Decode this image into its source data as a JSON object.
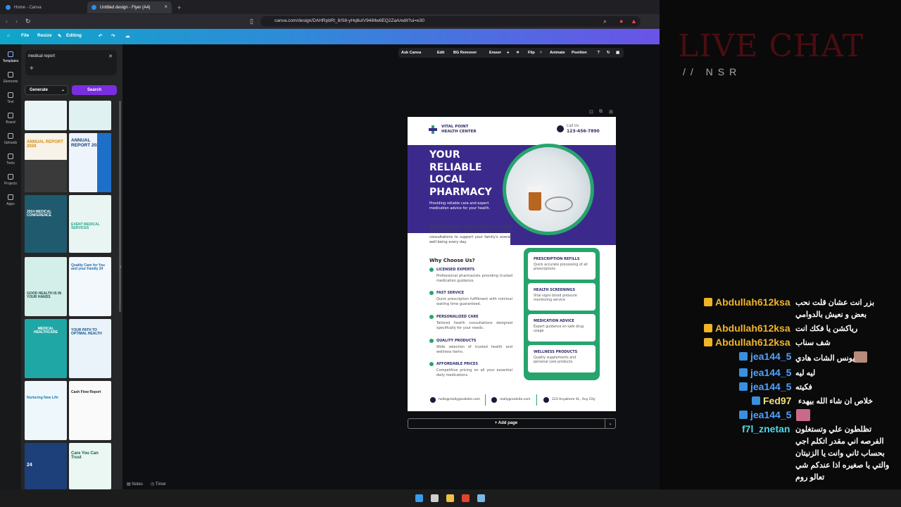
{
  "browser": {
    "tabs": [
      {
        "label": "Home - Canva",
        "active": false
      },
      {
        "label": "Untitled design - Flyer (A4)",
        "active": true
      }
    ],
    "url": "canva.com/design/DAHRpbRl_8/S8-yHq6uIV94iMw8EQ2ZaA/edit?ui=e30"
  },
  "canva_header": {
    "file": "File",
    "resize": "Resize",
    "editing": "Editing"
  },
  "rail": [
    {
      "label": "Templates",
      "icon": "templates-icon"
    },
    {
      "label": "Elements",
      "icon": "elements-icon"
    },
    {
      "label": "Text",
      "icon": "text-icon"
    },
    {
      "label": "Brand",
      "icon": "brand-icon"
    },
    {
      "label": "Uploads",
      "icon": "uploads-icon"
    },
    {
      "label": "Tools",
      "icon": "tools-icon"
    },
    {
      "label": "Projects",
      "icon": "projects-icon"
    },
    {
      "label": "Apps",
      "icon": "apps-icon"
    }
  ],
  "panel": {
    "search_value": "medical report",
    "generate": "Generate",
    "search": "Search",
    "thumbs": [
      {
        "text": "ANNUAL REPORT 2028"
      },
      {
        "text": "ANNUAL REPORT 2028"
      },
      {
        "text": "2024 MEDICAL CONFERENCE"
      },
      {
        "text": "EVENT MEDICAL SERVICES"
      },
      {
        "text": "GOOD HEALTH IS IN YOUR HANDS"
      },
      {
        "text": "Quality Care for You and your Family 24"
      },
      {
        "text": "MEDICAL HEALTHCARE"
      },
      {
        "text": "YOUR PATH TO OPTIMAL HEALTH"
      },
      {
        "text": "Nurturing New Life"
      },
      {
        "text": "Cash Flow Report"
      },
      {
        "text": "24"
      },
      {
        "text": "Care You Can Trust"
      }
    ],
    "notes": "Notes",
    "timer": "Timer"
  },
  "context_toolbar": {
    "ask_canva": "Ask Canva",
    "edit": "Edit",
    "bg_remover": "BG Remover",
    "eraser": "Eraser",
    "flip": "Flip",
    "animate": "Animate",
    "position": "Position"
  },
  "flyer": {
    "brand_line1": "VITAL POINT",
    "brand_line2": "HEALTH CENTER",
    "call_label": "Call Us",
    "phone": "123-456-7890",
    "headline": [
      "YOUR",
      "RELIABLE",
      "LOCAL",
      "PHARMACY"
    ],
    "subline": "Providing reliable care and expert medication advice for your health.",
    "intro": "We provide expert pharmaceutical care, high-quality healthcare products, and personalized consultations to support your family's overall well-being every day.",
    "why_title": "Why Choose Us?",
    "features": [
      {
        "title": "LICENSED EXPERTS",
        "desc": "Professional pharmacists providing trusted medication guidance."
      },
      {
        "title": "FAST SERVICE",
        "desc": "Quick prescription fulfillment with minimal waiting time guaranteed."
      },
      {
        "title": "PERSONALIZED CARE",
        "desc": "Tailored health consultations designed specifically for your needs."
      },
      {
        "title": "QUALITY PRODUCTS",
        "desc": "Wide selection of trusted health and wellness items."
      },
      {
        "title": "AFFORDABLE PRICES",
        "desc": "Competitive pricing on all your essential daily medications."
      }
    ],
    "services": [
      {
        "title": "PRESCRIPTION REFILLS",
        "desc": "Quick accurate processing of all prescriptions"
      },
      {
        "title": "HEALTH SCREENINGS",
        "desc": "Vital signs blood pressure monitoring service"
      },
      {
        "title": "MEDICATION ADVICE",
        "desc": "Expert guidance on safe drug usage"
      },
      {
        "title": "WELLNESS PRODUCTS",
        "desc": "Quality supplements and personal care products."
      }
    ],
    "footer": {
      "email": "hello@reallygreatsite.com",
      "site": "reallygreatsite.com",
      "address": "123 Anywhere St., Any City"
    }
  },
  "add_page": "+ Add page",
  "livechat": {
    "title": "LIVE CHAT",
    "subtitle": "// NSR",
    "messages": [
      {
        "user": "Abdullah612ksa",
        "text": "بزر انت عشان قلت نحب",
        "user_color": "#f0b429"
      },
      {
        "user": "",
        "text": "بعض و نعيش بالدوامي",
        "user_color": "#f0b429"
      },
      {
        "user": "Abdullah612ksa",
        "text": "رياكشن يا فكك انت",
        "user_color": "#f0b429"
      },
      {
        "user": "Abdullah612ksa",
        "text": "شف سناب",
        "user_color": "#f0b429"
      },
      {
        "user": "jea144_5",
        "text": "يونس الشات هادي",
        "user_color": "#4fa3ff"
      },
      {
        "user": "jea144_5",
        "text": "ليه ليه",
        "user_color": "#4fa3ff"
      },
      {
        "user": "jea144_5",
        "text": "فكيته",
        "user_color": "#4fa3ff"
      },
      {
        "user": "Fed97",
        "text": "خلاص ان شاء الله بيهدء",
        "user_color": "#f0e07a"
      },
      {
        "user": "jea144_5",
        "text": "",
        "user_color": "#4fa3ff"
      },
      {
        "user": "f7l_znetan",
        "text": "تظلطون علي وتستغلون",
        "user_color": "#4fd8e8"
      },
      {
        "user": "",
        "text": "الفرصه اني مقدر اتكلم اجي",
        "user_color": "#4fd8e8"
      },
      {
        "user": "",
        "text": "بحساب ثاني وانت يا الزنيتان",
        "user_color": "#4fd8e8"
      },
      {
        "user": "",
        "text": "والتي يا صغيره اذا عندكم شي",
        "user_color": "#4fd8e8"
      },
      {
        "user": "",
        "text": "تعالو روم",
        "user_color": "#4fd8e8"
      }
    ]
  }
}
